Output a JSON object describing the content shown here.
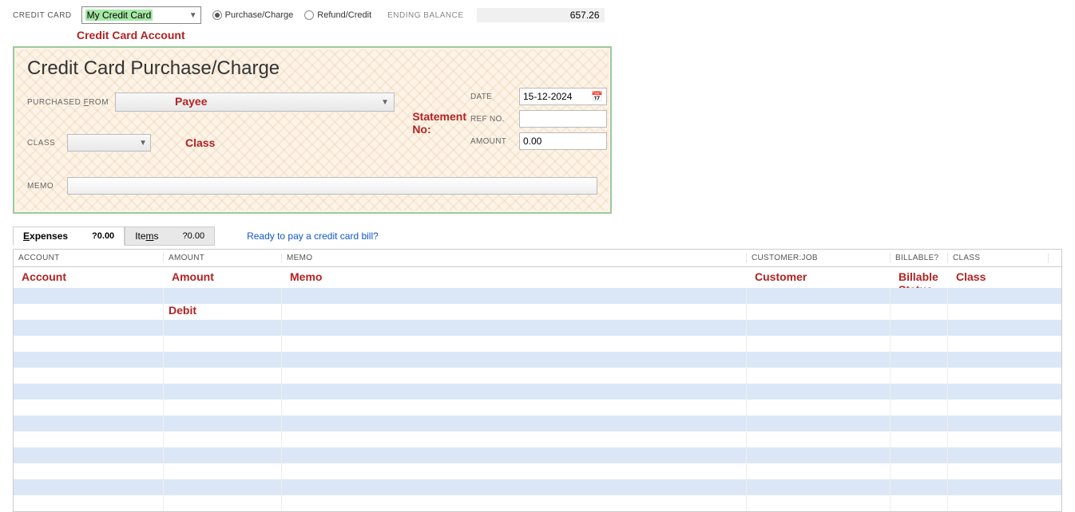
{
  "topbar": {
    "credit_card_label": "CREDIT CARD",
    "credit_card_value": "My Credit Card",
    "purchase_label": "Purchase/Charge",
    "refund_label": "Refund/Credit",
    "ending_balance_label": "ENDING BALANCE",
    "ending_balance_value": "657.26"
  },
  "annotations": {
    "credit_card_account": "Credit Card Account",
    "date": "Date",
    "payee": "Payee",
    "statement_no": "Statement No:",
    "class": "Class",
    "account": "Account",
    "amount": "Amount",
    "memo": "Memo",
    "customer": "Customer",
    "billable_status": "Billable Status",
    "class_col": "Class",
    "debit": "Debit"
  },
  "check": {
    "title": "Credit Card Purchase/Charge",
    "purchased_from_label": "PURCHASED FROM",
    "purchased_from_underline": "F",
    "class_label": "CLASS",
    "memo_label": "MEMO",
    "date_label": "DATE",
    "date_value": "15-12-2024",
    "ref_label": "REF NO.",
    "ref_value": "",
    "amount_label": "AMOUNT",
    "amount_value": "0.00",
    "memo_value": ""
  },
  "tabs": {
    "expenses_label": "Expenses",
    "expenses_prefix": "E",
    "expenses_rest": "xpenses",
    "expenses_amount": "?0.00",
    "items_label": "Items",
    "items_prefix": "Ite",
    "items_underline": "m",
    "items_suffix": "s",
    "items_amount": "?0.00",
    "ready_link": "Ready to pay a credit card bill?"
  },
  "table": {
    "headers": {
      "account": "ACCOUNT",
      "amount": "AMOUNT",
      "memo": "MEMO",
      "customer_job": "CUSTOMER:JOB",
      "billable": "BILLABLE?",
      "class": "CLASS"
    },
    "row_count": 14
  }
}
